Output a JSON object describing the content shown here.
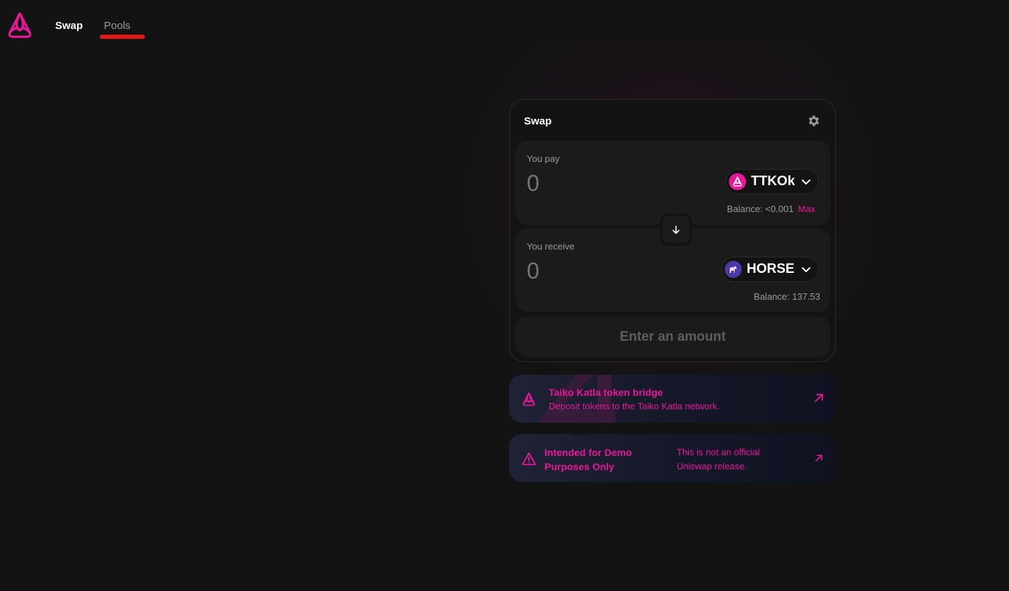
{
  "nav": {
    "swap_label": "Swap",
    "pools_label": "Pools"
  },
  "swap_card": {
    "title": "Swap",
    "pay": {
      "label": "You pay",
      "amount_placeholder": "0",
      "token": "TTKOk",
      "balance": "Balance: <0.001",
      "max_label": "Max"
    },
    "receive": {
      "label": "You receive",
      "amount_placeholder": "0",
      "token": "HORSE",
      "balance": "Balance: 137.53"
    },
    "action_label": "Enter an amount"
  },
  "bridge_banner": {
    "title": "Taiko Katla token bridge",
    "subtitle": "Deposit tokens to the Taiko Katla network."
  },
  "demo_banner": {
    "title": "Intended for Demo Purposes Only",
    "subtitle": "This is not an official Uniswap release."
  },
  "colors": {
    "accent": "#e81899",
    "background": "#131313",
    "panel": "#1b1b1b",
    "muted_text": "#9b9b9b",
    "pools_underline": "#e01818"
  },
  "icons": [
    "taiko-logo-icon",
    "gear-icon",
    "chevron-down-icon",
    "arrow-down-icon",
    "external-arrow-icon",
    "warning-icon",
    "horse-icon"
  ]
}
